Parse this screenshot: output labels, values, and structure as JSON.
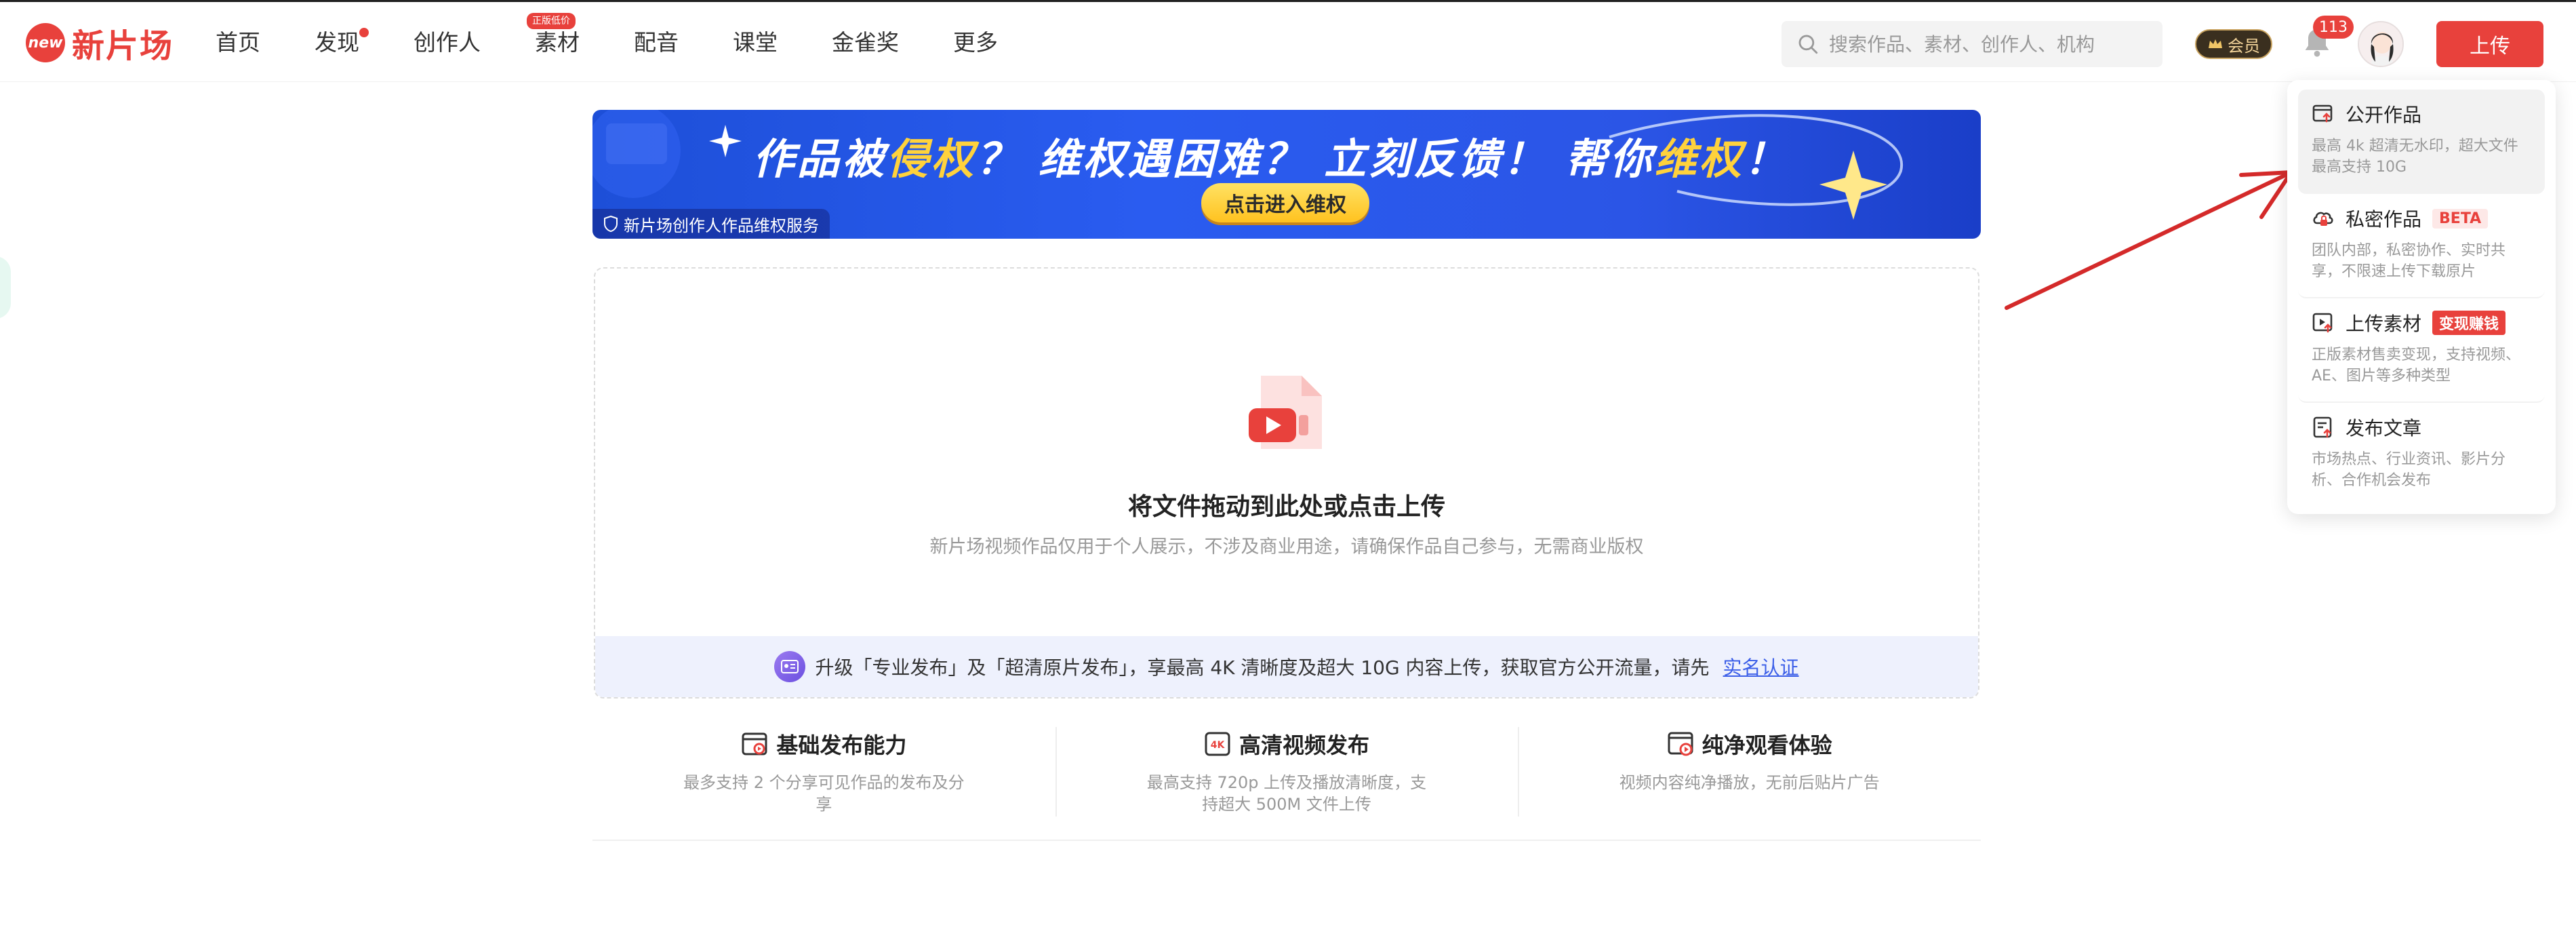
{
  "header": {
    "logo_badge": "new",
    "logo_text": "新片场",
    "nav": [
      {
        "label": "首页"
      },
      {
        "label": "发现",
        "dot": true
      },
      {
        "label": "创作人"
      },
      {
        "label": "素材",
        "tag": "正版低价"
      },
      {
        "label": "配音"
      },
      {
        "label": "课堂"
      },
      {
        "label": "金雀奖"
      },
      {
        "label": "更多"
      }
    ],
    "search_placeholder": "搜索作品、素材、创作人、机构",
    "vip_label": "会员",
    "notification_count": "113",
    "upload_label": "上传"
  },
  "banner": {
    "title_a": "作品被",
    "title_hl1": "侵权",
    "title_b": "？ 维权遇困难？ 立刻反馈！ 帮你",
    "title_hl2": "维权",
    "title_c": "！",
    "cta": "点击进入维权",
    "footer": "新片场创作人作品维权服务"
  },
  "dropzone": {
    "title": "将文件拖动到此处或点击上传",
    "subtitle": "新片场视频作品仅用于个人展示，不涉及商业用途，请确保作品自己参与，无需商业版权",
    "upgrade_text": "升级「专业发布」及「超清原片发布」，享最高 4K 清晰度及超大 10G 内容上传，获取官方公开流量，请先",
    "verify_link": "实名认证"
  },
  "features": [
    {
      "icon": "basic-publish-icon",
      "title": "基础发布能力",
      "desc": "最多支持 2 个分享可见作品的发布及分享"
    },
    {
      "icon": "4k-icon",
      "title": "高清视频发布",
      "desc": "最高支持 720p 上传及播放清晰度，支持超大 500M 文件上传"
    },
    {
      "icon": "clean-play-icon",
      "title": "纯净观看体验",
      "desc": "视频内容纯净播放，无前后贴片广告"
    }
  ],
  "menu": [
    {
      "title": "公开作品",
      "desc": "最高 4k 超清无水印，超大文件最高支持 10G",
      "active": true
    },
    {
      "title": "私密作品",
      "tag": "BETA",
      "desc": "团队内部，私密协作、实时共享，不限速上传下载原片"
    },
    {
      "title": "上传素材",
      "tag": "变现赚钱",
      "desc": "正版素材售卖变现，支持视频、AE、图片等多种类型"
    },
    {
      "title": "发布文章",
      "desc": "市场热点、行业资讯、影片分析、合作机会发布"
    }
  ],
  "colors": {
    "brand": "#e8413c",
    "link": "#3b5ee8",
    "banner_blue": "#2a5cf0",
    "banner_yellow": "#ffd23c"
  }
}
